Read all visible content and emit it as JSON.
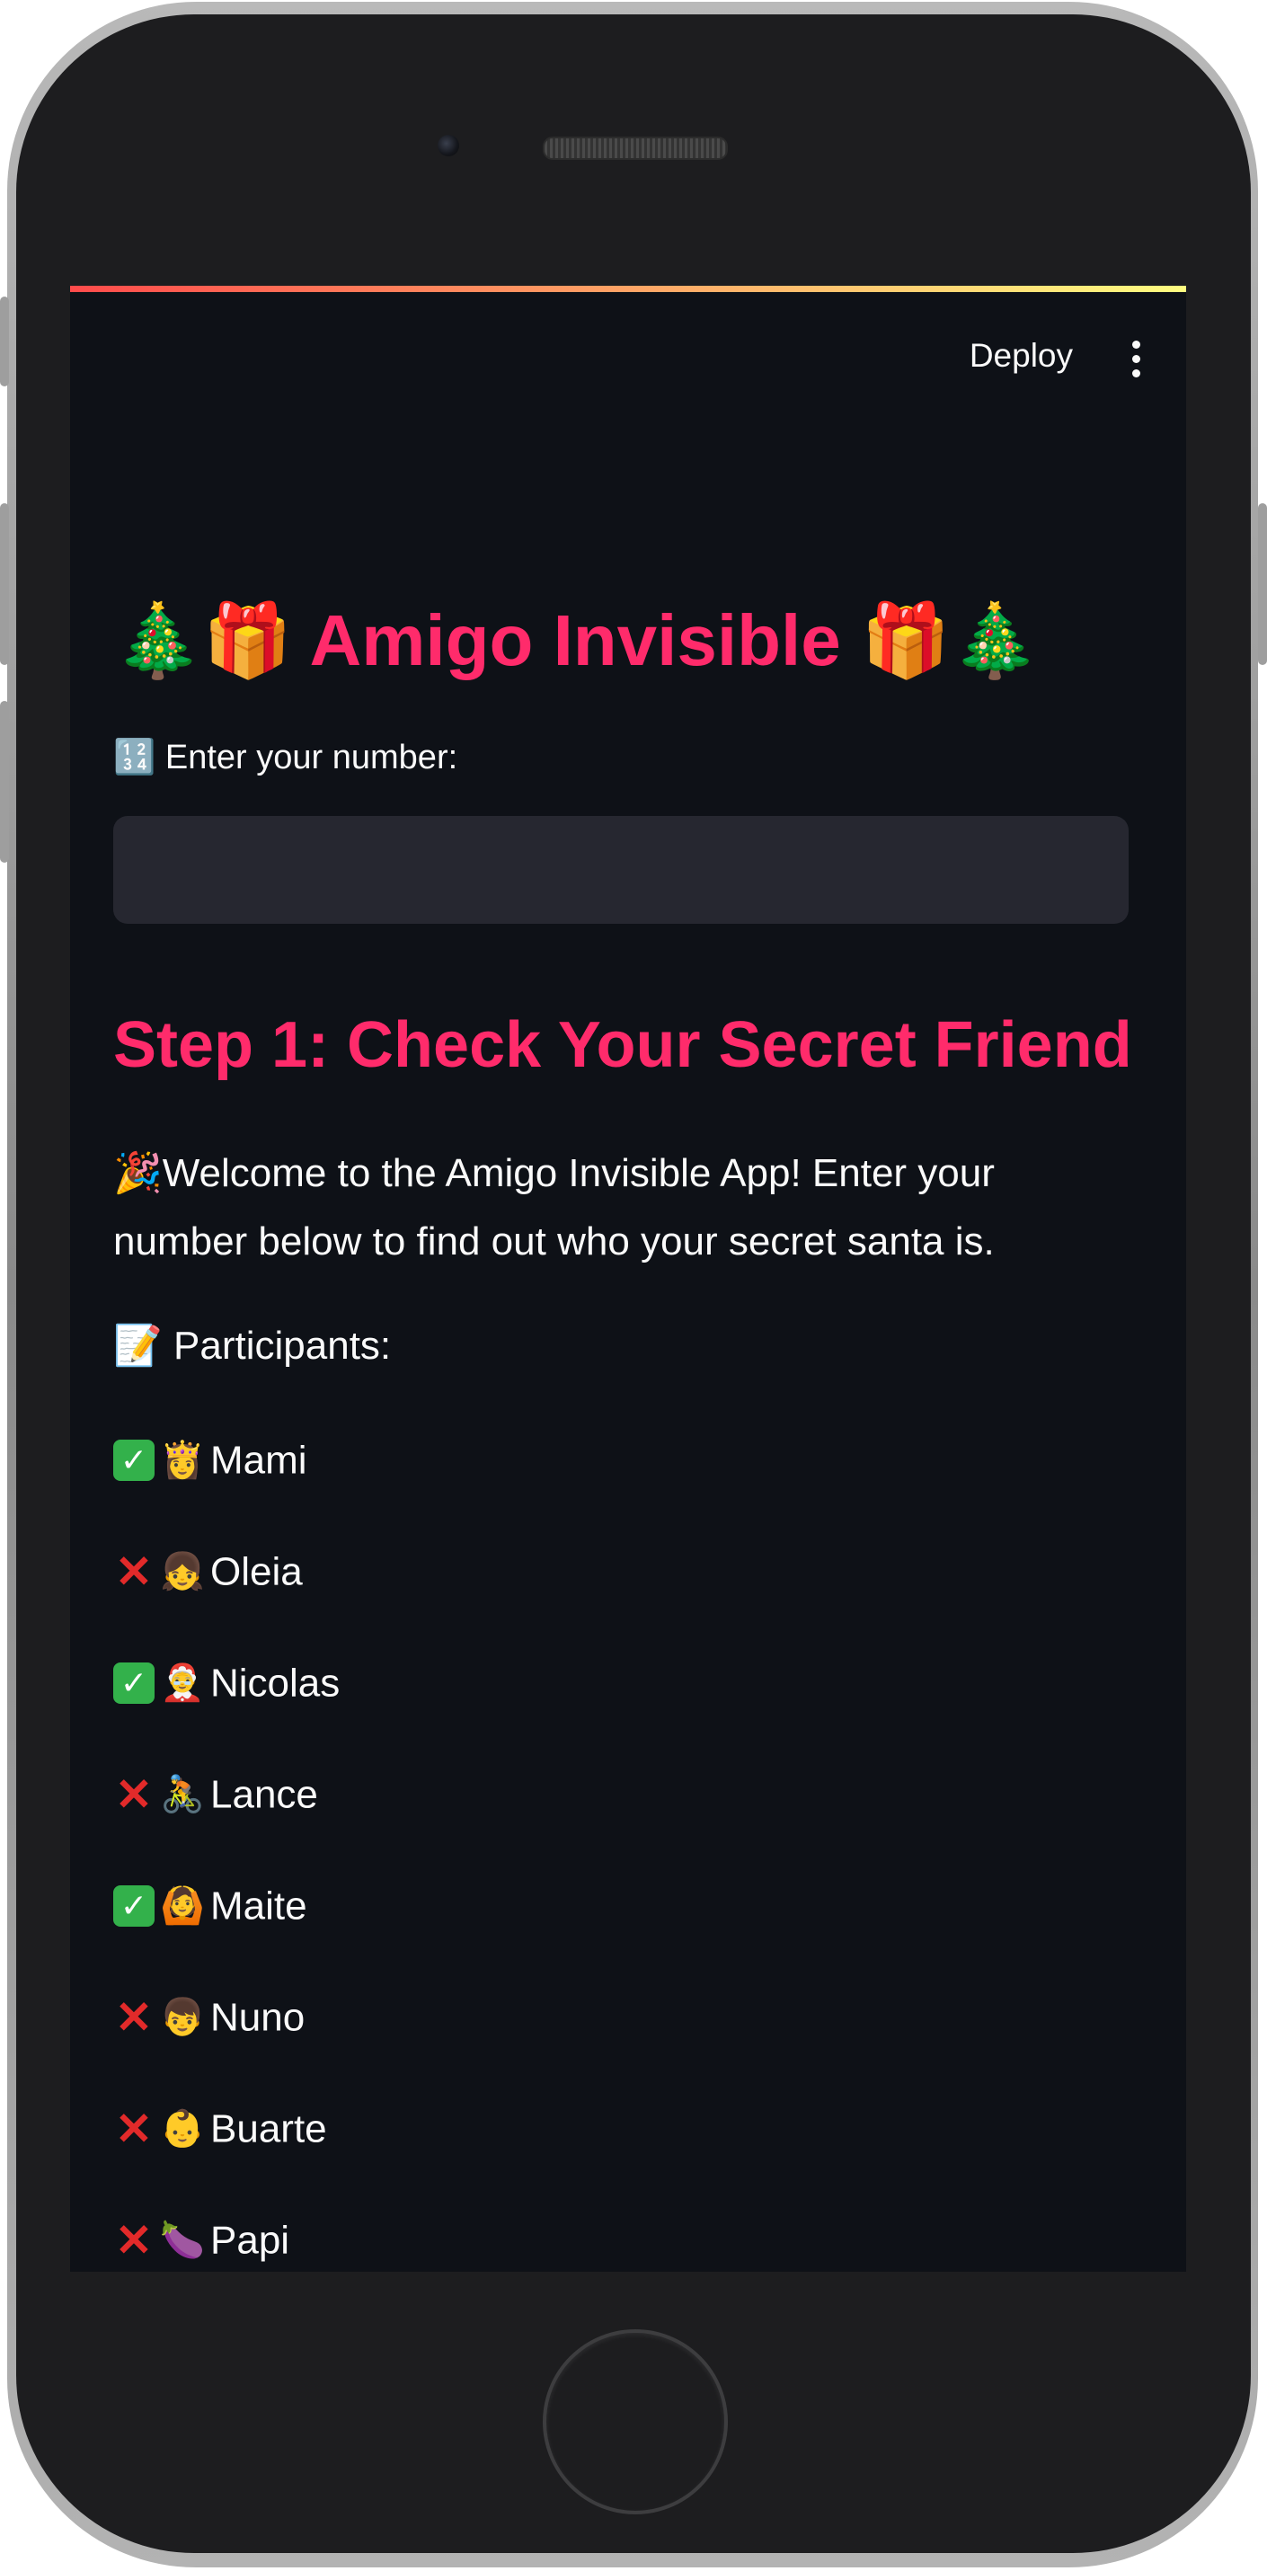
{
  "app": {
    "title_prefix_icons": "🎄🎁",
    "title_text": "Amigo Invisible",
    "title_suffix_icons": "🎁🎄"
  },
  "toolbar": {
    "deploy_label": "Deploy",
    "menu_icon": "more-vertical-icon"
  },
  "number_input": {
    "label_icon": "🔢",
    "label": "Enter your number:",
    "value": ""
  },
  "step1": {
    "heading": "Step 1: Check Your Secret Friend",
    "welcome_icon": "🎉",
    "welcome_text": "Welcome to the Amigo Invisible App! Enter your number below to find out who your secret santa is.",
    "participants_icon": "📝",
    "participants_label": "Participants:"
  },
  "participants": [
    {
      "status": "checked",
      "status_icon": "✓",
      "avatar": "👸",
      "name": "Mami"
    },
    {
      "status": "unchecked",
      "status_icon": "✕",
      "avatar": "👧",
      "name": "Oleia"
    },
    {
      "status": "checked",
      "status_icon": "✓",
      "avatar": "🤶",
      "name": "Nicolas"
    },
    {
      "status": "unchecked",
      "status_icon": "✕",
      "avatar": "🚴",
      "name": "Lance"
    },
    {
      "status": "checked",
      "status_icon": "✓",
      "avatar": "🙆",
      "name": "Maite"
    },
    {
      "status": "unchecked",
      "status_icon": "✕",
      "avatar": "👦",
      "name": "Nuno"
    },
    {
      "status": "unchecked",
      "status_icon": "✕",
      "avatar": "👶",
      "name": "Buarte"
    },
    {
      "status": "unchecked",
      "status_icon": "✕",
      "avatar": "🍆",
      "name": "Papi"
    }
  ],
  "colors": {
    "accent": "#ff2b6b",
    "background": "#0e1117",
    "input_background": "#262730",
    "text": "#fafafa",
    "check_green": "#33b14b",
    "cross_red": "#e22a2a",
    "decoration_gradient_start": "#ff4b4b",
    "decoration_gradient_end": "#fffd80"
  }
}
